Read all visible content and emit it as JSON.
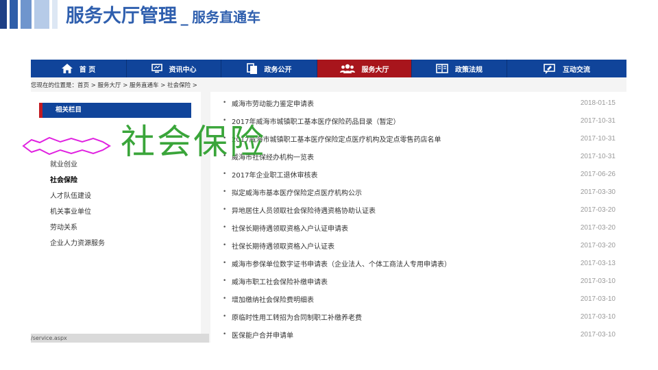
{
  "slide": {
    "title_main": "服务大厅管理",
    "title_sep": "_",
    "title_sub": "服务直通车"
  },
  "nav": {
    "items": [
      {
        "label": "首 页",
        "icon": "home-icon"
      },
      {
        "label": "资讯中心",
        "icon": "monitor-icon"
      },
      {
        "label": "政务公开",
        "icon": "document-icon"
      },
      {
        "label": "服务大厅",
        "icon": "users-icon",
        "active": true
      },
      {
        "label": "政策法规",
        "icon": "book-icon"
      },
      {
        "label": "互动交流",
        "icon": "chat-icon"
      }
    ],
    "active_color": "#a8151c",
    "bar_color": "#10449a"
  },
  "breadcrumb": "您现在的位置是：首页 > 服务大厅 > 服务直通车 > 社会保险 >",
  "sidebar": {
    "header": "相关栏目",
    "items": [
      "就业创业",
      "社会保险",
      "人才队伍建设",
      "机关事业单位",
      "劳动关系",
      "企业人力资源服务"
    ],
    "active_index": 1
  },
  "status_url": "/service.aspx",
  "list": [
    {
      "title": "威海市劳动能力鉴定申请表",
      "date": "2018-01-15"
    },
    {
      "title": "2017年威海市城镇职工基本医疗保险药品目录（暂定）",
      "date": "2017-10-31"
    },
    {
      "title": "2017威海市城镇职工基本医疗保险定点医疗机构及定点零售药店名单",
      "date": "2017-10-31"
    },
    {
      "title": "威海市社保经办机构一览表",
      "date": "2017-10-31"
    },
    {
      "title": "2017年企业职工退休审核表",
      "date": "2017-06-26"
    },
    {
      "title": "拟定威海市基本医疗保险定点医疗机构公示",
      "date": "2017-03-30"
    },
    {
      "title": "异地居住人员领取社会保险待遇资格协助认证表",
      "date": "2017-03-20"
    },
    {
      "title": "社保长期待遇领取资格入户认证申请表",
      "date": "2017-03-20"
    },
    {
      "title": "社保长期待遇领取资格入户认证表",
      "date": "2017-03-20"
    },
    {
      "title": "威海市参保单位数字证书申请表（企业法人、个体工商法人专用申请表）",
      "date": "2017-03-13"
    },
    {
      "title": "威海市职工社会保险补缴申请表",
      "date": "2017-03-10"
    },
    {
      "title": "增加缴纳社会保险费明细表",
      "date": "2017-03-10"
    },
    {
      "title": "原临时性用工转招为合同制职工补缴养老费",
      "date": "2017-03-10"
    },
    {
      "title": "医保能户合并申请单",
      "date": "2017-03-10"
    }
  ],
  "overlay_label": "社会保险",
  "colors": {
    "title_blue": "#2f5fae",
    "overlay_green": "#3aa53a",
    "highlight_magenta": "#e020e0"
  }
}
